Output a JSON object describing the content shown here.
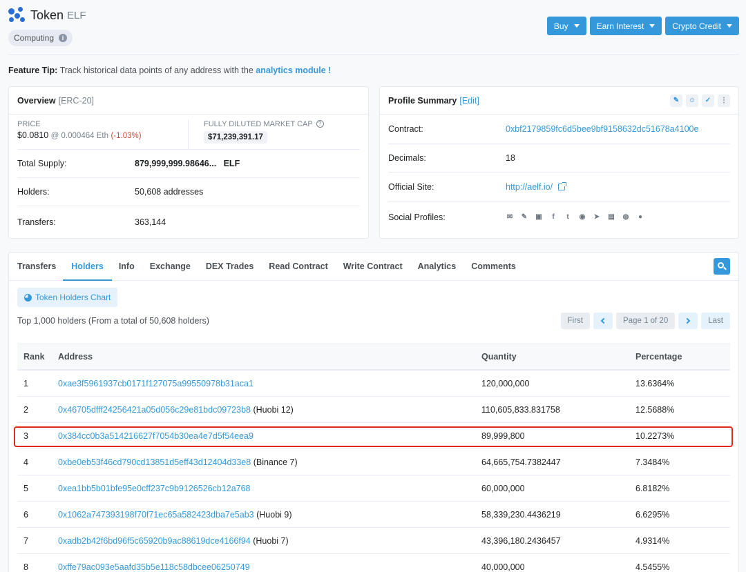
{
  "header": {
    "brand": "Token",
    "symbol": "ELF",
    "computing": "Computing",
    "buttons": [
      "Buy",
      "Earn Interest",
      "Crypto Credit"
    ]
  },
  "tip": {
    "label": "Feature Tip:",
    "text": "Track historical data points of any address with the",
    "link": "analytics module !"
  },
  "overview": {
    "title": "Overview",
    "standard": "[ERC-20]",
    "price_label": "PRICE",
    "price": "$0.0810",
    "price_eth": "@ 0.000464 Eth",
    "price_change": "(-1.03%)",
    "mcap_label": "FULLY DILUTED MARKET CAP",
    "mcap": "$71,239,391.17",
    "total_supply_label": "Total Supply:",
    "total_supply": "879,999,999.98646...",
    "total_supply_symbol": "ELF",
    "holders_label": "Holders:",
    "holders": "50,608 addresses",
    "transfers_label": "Transfers:",
    "transfers": "363,144"
  },
  "profile": {
    "title": "Profile Summary",
    "edit": "[Edit]",
    "contract_label": "Contract:",
    "contract": "0xbf2179859fc6d5bee9bf9158632dc51678a4100e",
    "decimals_label": "Decimals:",
    "decimals": "18",
    "site_label": "Official Site:",
    "site": "http://aelf.io/",
    "social_label": "Social Profiles:"
  },
  "tabs": [
    "Transfers",
    "Holders",
    "Info",
    "Exchange",
    "DEX Trades",
    "Read Contract",
    "Write Contract",
    "Analytics",
    "Comments"
  ],
  "holders": {
    "chart_button": "Token Holders Chart",
    "summary": "Top 1,000 holders (From a total of 50,608 holders)",
    "pager": {
      "first": "First",
      "page": "Page 1 of 20",
      "last": "Last"
    },
    "columns": [
      "Rank",
      "Address",
      "Quantity",
      "Percentage"
    ],
    "rows": [
      {
        "rank": "1",
        "address": "0xae3f5961937cb0171f127075a99550978b31aca1",
        "label": "",
        "qty": "120,000,000",
        "pct": "13.6364%"
      },
      {
        "rank": "2",
        "address": "0x46705dfff24256421a05d056c29e81bdc09723b8",
        "label": "(Huobi 12)",
        "qty": "110,605,833.831758",
        "pct": "12.5688%"
      },
      {
        "rank": "3",
        "address": "0x384cc0b3a514216627f7054b30ea4e7d5f54eea9",
        "label": "",
        "qty": "89,999,800",
        "pct": "10.2273%"
      },
      {
        "rank": "4",
        "address": "0xbe0eb53f46cd790cd13851d5eff43d12404d33e8",
        "label": "(Binance 7)",
        "qty": "64,665,754.7382447",
        "pct": "7.3484%"
      },
      {
        "rank": "5",
        "address": "0xea1bb5b01bfe95e0cff237c9b9126526cb12a768",
        "label": "",
        "qty": "60,000,000",
        "pct": "6.8182%"
      },
      {
        "rank": "6",
        "address": "0x1062a747393198f70f71ec65a582423dba7e5ab3",
        "label": "(Huobi 9)",
        "qty": "58,339,230.4436219",
        "pct": "6.6295%"
      },
      {
        "rank": "7",
        "address": "0xadb2b42f6bd96f5c65920b9ac88619dce4166f94",
        "label": "(Huobi 7)",
        "qty": "43,396,180.2436457",
        "pct": "4.9314%"
      },
      {
        "rank": "8",
        "address": "0xffe79ac093e5aafd35b5e118c58dbcee06250749",
        "label": "",
        "qty": "40,000,000",
        "pct": "4.5455%"
      }
    ]
  },
  "colors": {
    "accent": "#3498db",
    "negative": "#de4437",
    "highlight": "#e0271a"
  }
}
